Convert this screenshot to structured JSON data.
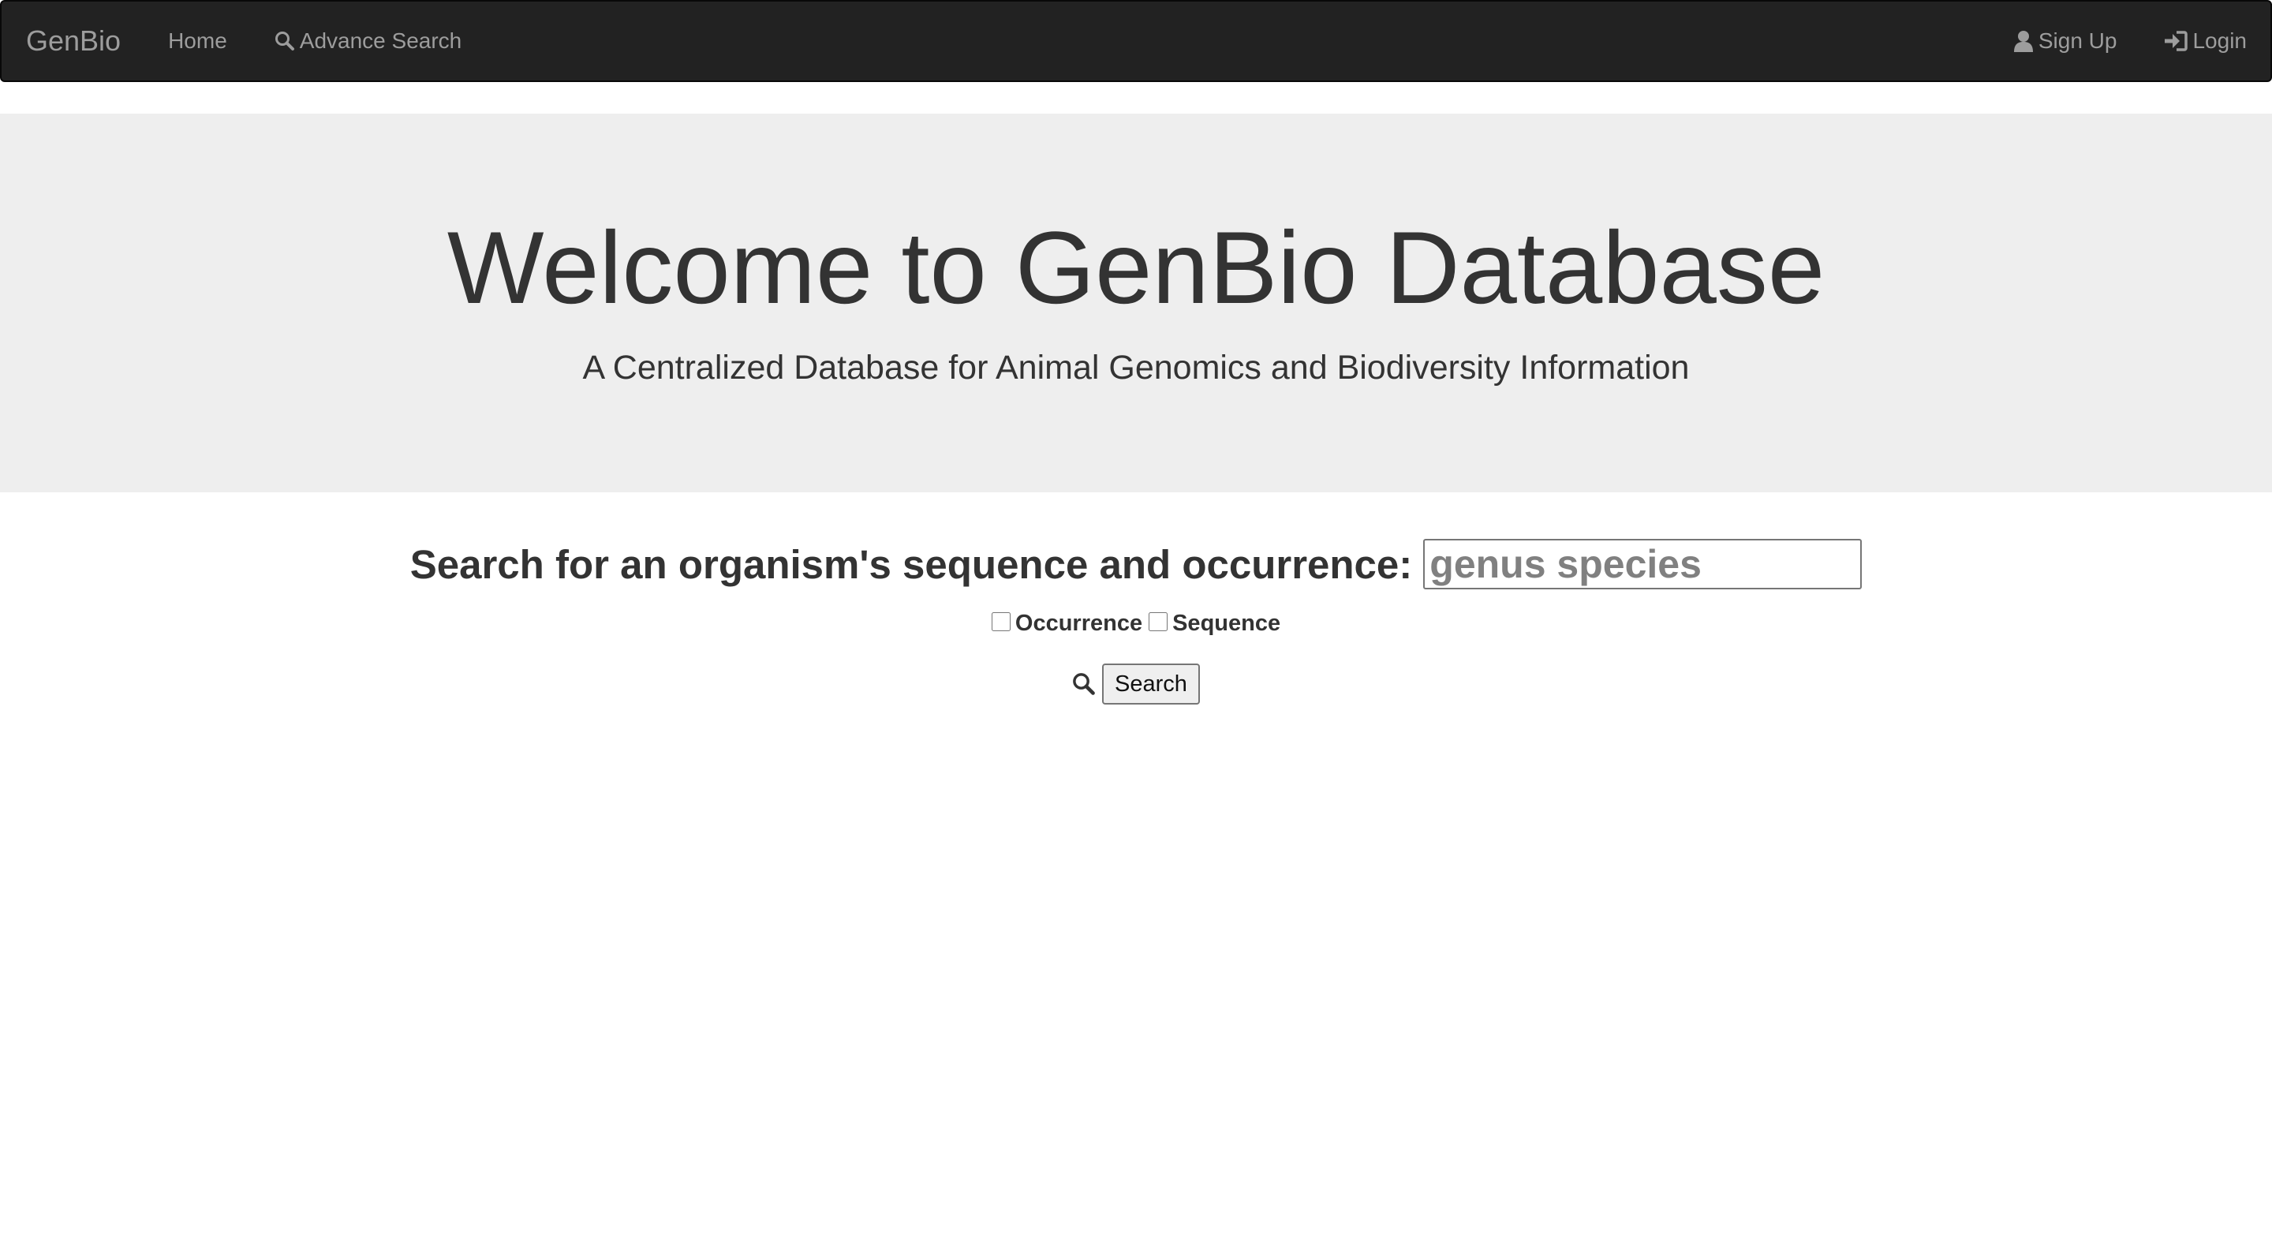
{
  "navbar": {
    "brand": "GenBio",
    "home": "Home",
    "advance_search": "Advance Search",
    "sign_up": "Sign Up",
    "login": "Login",
    "background_color": "#222222",
    "link_color": "#9d9d9d"
  },
  "jumbotron": {
    "title": "Welcome to GenBio Database",
    "subtitle": "A Centralized Database for Animal Genomics and Biodiversity Information",
    "background_color": "#eeeeee"
  },
  "search": {
    "label": "Search for an organism's sequence and occurrence:",
    "placeholder": "genus species",
    "value": "",
    "options": [
      {
        "label": "Occurrence",
        "checked": false
      },
      {
        "label": "Sequence",
        "checked": false
      }
    ],
    "button_label": "Search"
  }
}
